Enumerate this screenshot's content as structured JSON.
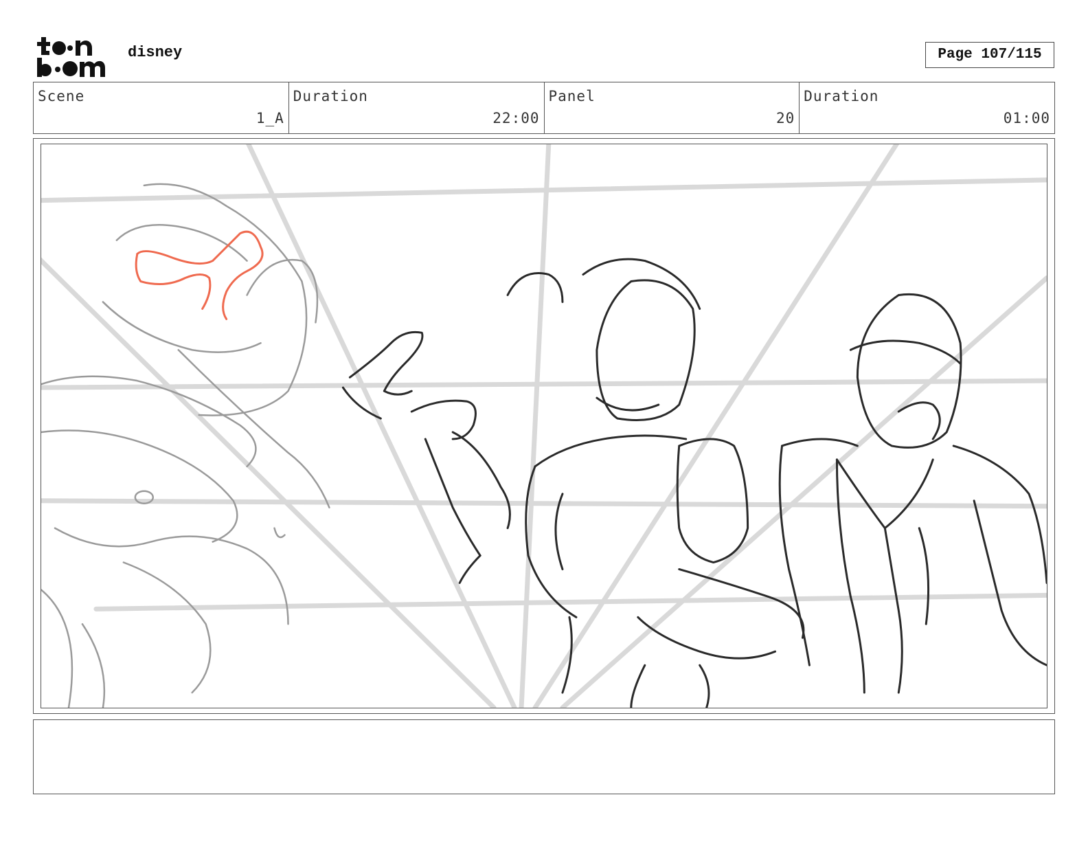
{
  "header": {
    "logo_text": "toon boom",
    "project_name": "disney",
    "page_label": "Page 107/115"
  },
  "info": {
    "scene_label": "Scene",
    "scene_value": "1_A",
    "scene_duration_label": "Duration",
    "scene_duration_value": "22:00",
    "panel_label": "Panel",
    "panel_value": "20",
    "panel_duration_label": "Duration",
    "panel_duration_value": "01:00"
  },
  "panel": {
    "sketch_colors": {
      "guide": "#d8d8d8",
      "rough": "#9a9a9a",
      "line": "#2a2a2a",
      "accent": "#ef6a4f"
    }
  },
  "notes": {
    "text": ""
  }
}
